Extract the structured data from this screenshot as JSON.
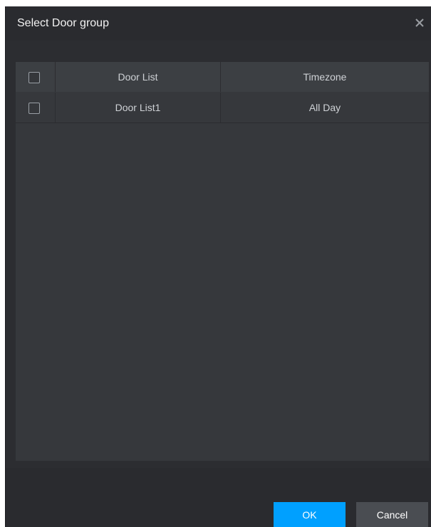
{
  "dialog": {
    "title": "Select Door group",
    "close_icon": "close-icon"
  },
  "table": {
    "columns": [
      "Door List",
      "Timezone"
    ],
    "rows": [
      {
        "door": "Door List1",
        "timezone": "All Day",
        "checked": false
      }
    ],
    "select_all_checked": false
  },
  "buttons": {
    "ok_label": "OK",
    "cancel_label": "Cancel"
  },
  "colors": {
    "accent": "#00a0ff",
    "dialog_bg": "#2a2b2f",
    "table_bg": "#36383c",
    "header_bg": "#3c3f43"
  }
}
